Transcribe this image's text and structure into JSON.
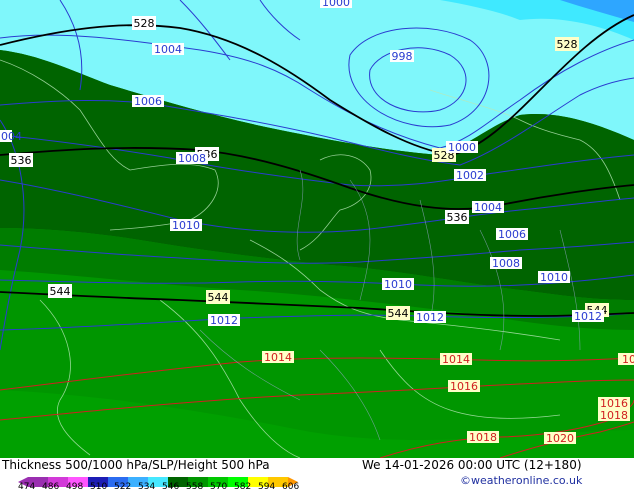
{
  "footer": {
    "title": "Thickness 500/1000 hPa/SLP/Height 500 hPa",
    "datetime": "We 14-01-2026 00:00 UTC (12+180)",
    "credit": "©weatheronline.co.uk"
  },
  "colorbar": {
    "ticks": [
      "474",
      "486",
      "498",
      "510",
      "522",
      "534",
      "546",
      "558",
      "570",
      "582",
      "594",
      "606"
    ],
    "colors": [
      "#9a2fb0",
      "#d23ad8",
      "#ff55ff",
      "#1d1db5",
      "#2b6cf0",
      "#3cb0ff",
      "#46e8ff",
      "#006400",
      "#009600",
      "#00c800",
      "#00ff00",
      "#ffff00",
      "#ffc800",
      "#ff9600"
    ]
  },
  "map": {
    "colors": {
      "light_cyan": "#7ff7fb",
      "cyan": "#3fe9ff",
      "blue": "#2ea6ff",
      "dark_green": "#006400",
      "mid_green": "#007d00",
      "green": "#009600",
      "bright_green": "#00a000",
      "black_contour": "#000000",
      "blue_isobar": "#2a3cd0",
      "red_isobar": "#d02020"
    },
    "height_labels": [
      "528",
      "528",
      "528",
      "536",
      "536",
      "536",
      "544",
      "544",
      "544",
      "544"
    ],
    "slp_labels": [
      "1000",
      "1004",
      "998",
      "1000",
      "1006",
      "1008",
      "1002",
      "1004",
      "1010",
      "1006",
      "1008",
      "1010",
      "1010",
      "1012",
      "1012",
      "1012",
      "1014",
      "1014",
      "1016",
      "1016",
      "1018",
      "1018",
      "1020",
      "1018",
      "1004"
    ]
  }
}
